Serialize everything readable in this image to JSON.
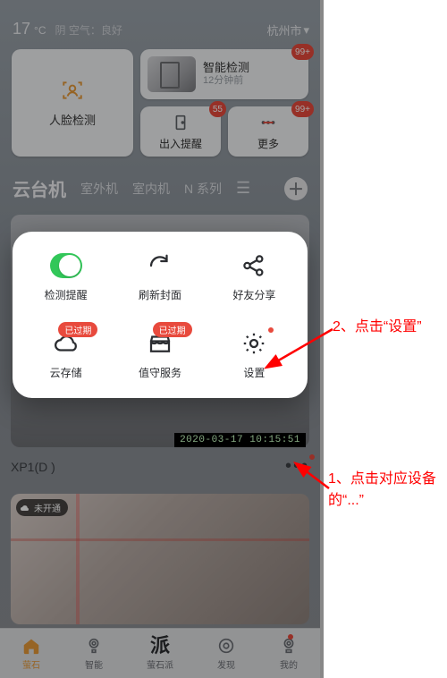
{
  "weather": {
    "temp": "17",
    "unit": "°C",
    "desc": "阴 空气：良好"
  },
  "location": {
    "city": "杭州市"
  },
  "top_cards": {
    "face": {
      "label": "人脸检测"
    },
    "smart": {
      "title": "智能检测",
      "time": "12分钟前",
      "badge": "99+"
    },
    "io": {
      "label": "出入提醒",
      "badge": "55"
    },
    "more": {
      "label": "更多",
      "badge": "99+"
    }
  },
  "tabs": {
    "items": [
      "云台机",
      "室外机",
      "室内机",
      "N 系列"
    ],
    "active_index": 0
  },
  "camera_timestamp": "2020-03-17 10:15:51",
  "device": {
    "name": "XP1(D                     )"
  },
  "lower_pill": {
    "label": "未开通"
  },
  "nav": {
    "items": [
      {
        "label": "萤石",
        "active": true
      },
      {
        "label": "智能"
      },
      {
        "label": "萤石派",
        "glyph": "派"
      },
      {
        "label": "发现"
      },
      {
        "label": "我的",
        "dot": true
      }
    ]
  },
  "modal": {
    "items": [
      {
        "label": "检测提醒",
        "icon": "toggle"
      },
      {
        "label": "刷新封面",
        "icon": "refresh"
      },
      {
        "label": "好友分享",
        "icon": "share"
      },
      {
        "label": "云存储",
        "icon": "cloud",
        "badge": "已过期"
      },
      {
        "label": "值守服务",
        "icon": "shop",
        "badge": "已过期"
      },
      {
        "label": "设置",
        "icon": "gear",
        "dot": true
      }
    ]
  },
  "annotations": {
    "a1": "1、点击对应设备的“...”",
    "a2": "2、点击“设置”"
  }
}
